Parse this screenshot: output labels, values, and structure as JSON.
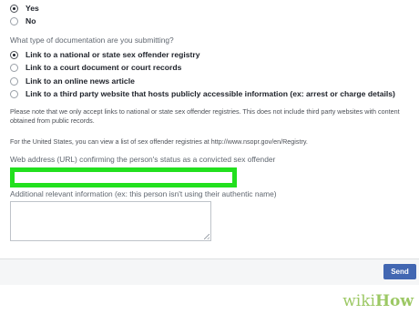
{
  "status_options": [
    {
      "label": "Yes",
      "selected": true
    },
    {
      "label": "No",
      "selected": false
    }
  ],
  "documentation": {
    "question": "What type of documentation are you submitting?",
    "options": [
      {
        "label": "Link to a national or state sex offender registry",
        "selected": true
      },
      {
        "label": "Link to a court document or court records",
        "selected": false
      },
      {
        "label": "Link to an online news article",
        "selected": false
      },
      {
        "label": "Link to a third party website that hosts publicly accessible information (ex: arrest or charge details)",
        "selected": false
      }
    ]
  },
  "notes": {
    "registry_note": "Please note that we only accept links to national or state sex offender registries. This does not include third party websites with content obtained from public records.",
    "us_note": "For the United States, you can view a list of sex offender registries at http://www.nsopr.gov/en/Registry."
  },
  "url_field": {
    "label": "Web address (URL) confirming the person's status as a convicted sex offender",
    "value": "",
    "highlight_color": "#22e01e"
  },
  "additional_info": {
    "label": "Additional relevant information (ex: this person isn't using their authentic name)",
    "value": ""
  },
  "footer": {
    "send_label": "Send",
    "button_color": "#4267b2"
  },
  "watermark": {
    "wiki": "wiki",
    "how": "How"
  }
}
